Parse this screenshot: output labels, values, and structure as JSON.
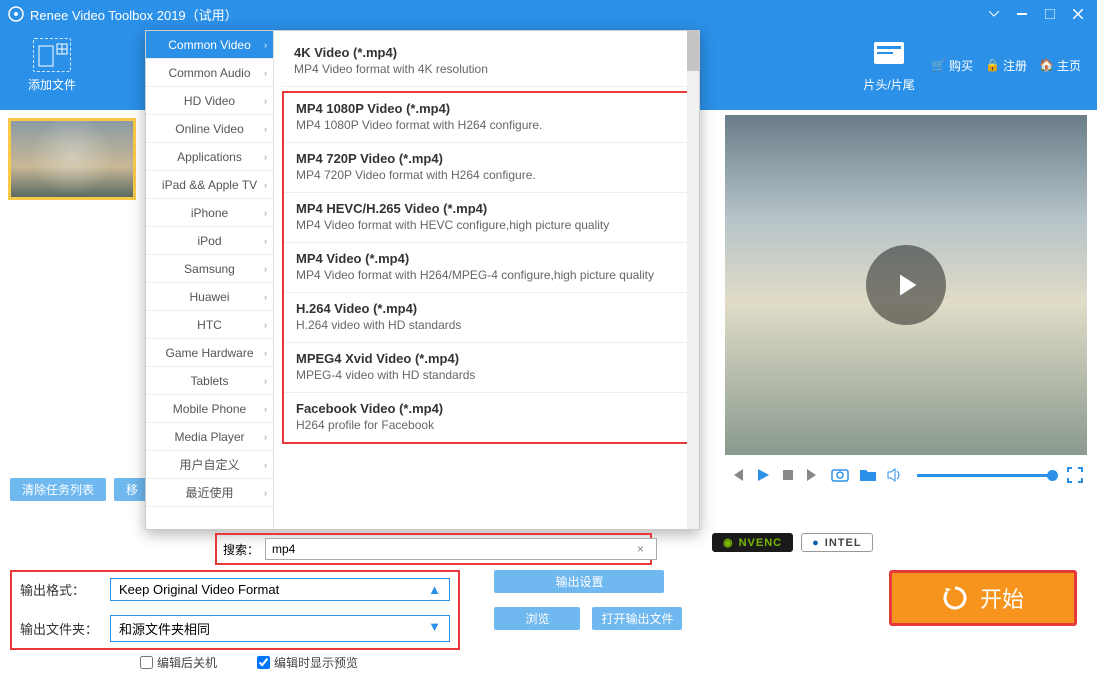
{
  "app": {
    "title": "Renee Video Toolbox 2019（试用）"
  },
  "toolbar": {
    "add": "添加文件",
    "credits": "片头/片尾"
  },
  "links": {
    "buy": "购买",
    "reg": "注册",
    "home": "主页"
  },
  "queue": {
    "clear": "清除任务列表",
    "move": "移"
  },
  "categories": [
    "Common Video",
    "Common Audio",
    "HD Video",
    "Online Video",
    "Applications",
    "iPad && Apple TV",
    "iPhone",
    "iPod",
    "Samsung",
    "Huawei",
    "HTC",
    "Game Hardware",
    "Tablets",
    "Mobile Phone",
    "Media Player",
    "用户自定义",
    "最近使用"
  ],
  "categories_sel": 0,
  "formats_top": {
    "name": "4K Video (*.mp4)",
    "desc": "MP4 Video format with 4K resolution"
  },
  "formats": [
    {
      "name": "MP4 1080P Video (*.mp4)",
      "desc": "MP4 1080P Video format with H264 configure."
    },
    {
      "name": "MP4 720P Video (*.mp4)",
      "desc": "MP4 720P Video format with H264 configure."
    },
    {
      "name": "MP4 HEVC/H.265 Video (*.mp4)",
      "desc": "MP4 Video format with HEVC configure,high picture quality"
    },
    {
      "name": "MP4 Video (*.mp4)",
      "desc": "MP4 Video format with H264/MPEG-4 configure,high picture quality"
    },
    {
      "name": "H.264 Video (*.mp4)",
      "desc": "H.264 video with HD standards"
    },
    {
      "name": "MPEG4 Xvid Video (*.mp4)",
      "desc": "MPEG-4 video with HD standards"
    },
    {
      "name": "Facebook Video (*.mp4)",
      "desc": "H264 profile for Facebook"
    }
  ],
  "search": {
    "label": "搜索：",
    "value": "mp4"
  },
  "hw": {
    "nvenc": "NVENC",
    "intel": "INTEL"
  },
  "out": {
    "format_label": "输出格式：",
    "format_value": "Keep Original Video Format",
    "folder_label": "输出文件夹：",
    "folder_value": "和源文件夹相同",
    "settings": "输出设置",
    "browse": "浏览",
    "openout": "打开输出文件",
    "chk_shutdown": "编辑后关机",
    "chk_preview": "编辑时显示预览"
  },
  "start": "开始"
}
